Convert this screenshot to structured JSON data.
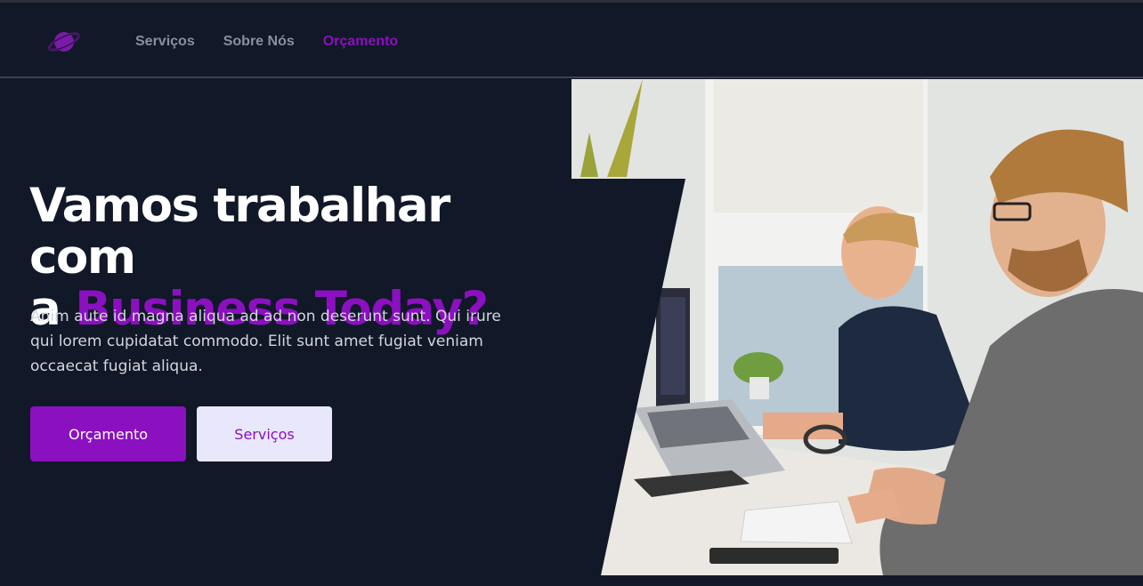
{
  "header": {
    "nav": [
      {
        "label": "Serviços",
        "active": false
      },
      {
        "label": "Sobre Nós",
        "active": false
      },
      {
        "label": "Orçamento",
        "active": true
      }
    ],
    "logo_icon": "planet-icon"
  },
  "hero": {
    "title_line1": "Vamos trabalhar com",
    "title_line2_prefix": "a ",
    "title_accent": "Business Today?",
    "description": "Anim aute id magna aliqua ad ad non deserunt sunt. Qui irure qui lorem cupidatat commodo. Elit sunt amet fugiat veniam occaecat fugiat aliqua.",
    "primary_button": "Orçamento",
    "secondary_button": "Serviços"
  },
  "colors": {
    "background": "#111827",
    "accent": "#8b10c0",
    "secondary_button_bg": "#e8e7fb",
    "nav_text": "#8a8f9c"
  }
}
